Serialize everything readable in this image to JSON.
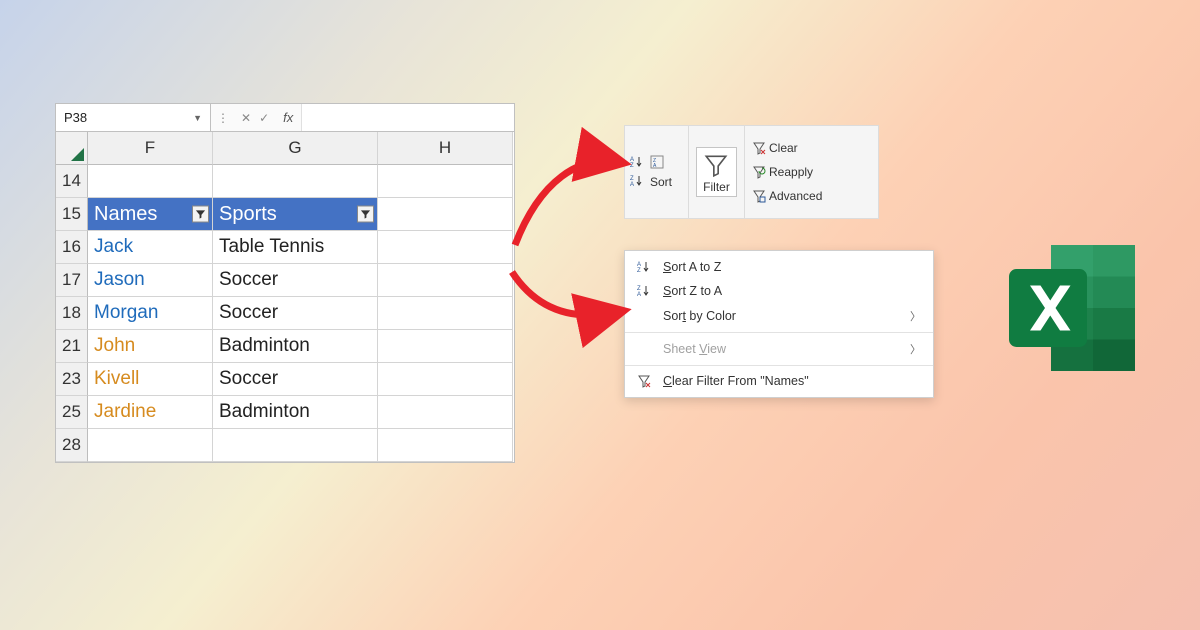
{
  "formula_bar": {
    "cell_ref": "P38",
    "fx_label": "fx"
  },
  "columns": [
    "F",
    "G",
    "H"
  ],
  "rows": [
    {
      "num": "14",
      "name": "",
      "sport": ""
    },
    {
      "num": "15",
      "name": "Names",
      "sport": "Sports",
      "is_header": true
    },
    {
      "num": "16",
      "name": "Jack",
      "sport": "Table Tennis",
      "color": "blue"
    },
    {
      "num": "17",
      "name": "Jason",
      "sport": "Soccer",
      "color": "blue"
    },
    {
      "num": "18",
      "name": "Morgan",
      "sport": "Soccer",
      "color": "blue"
    },
    {
      "num": "21",
      "name": "John",
      "sport": "Badminton",
      "color": "orange"
    },
    {
      "num": "23",
      "name": "Kivell",
      "sport": "Soccer",
      "color": "orange"
    },
    {
      "num": "25",
      "name": "Jardine",
      "sport": "Badminton",
      "color": "orange"
    },
    {
      "num": "28",
      "name": "",
      "sport": ""
    }
  ],
  "ribbon": {
    "sort_label": "Sort",
    "filter_label": "Filter",
    "clear": "Clear",
    "reapply": "Reapply",
    "advanced": "Advanced"
  },
  "context_menu": {
    "sort_az": "Sort A to Z",
    "sort_za": "Sort Z to A",
    "sort_color_pre": "Sor",
    "sort_color_u": "t",
    "sort_color_post": " by Color",
    "sheet_view_pre": "Sheet ",
    "sheet_view_u": "V",
    "sheet_view_post": "iew",
    "clear_filter_pre": "",
    "clear_filter_u": "C",
    "clear_filter_post": "lear Filter From \"Names\""
  }
}
